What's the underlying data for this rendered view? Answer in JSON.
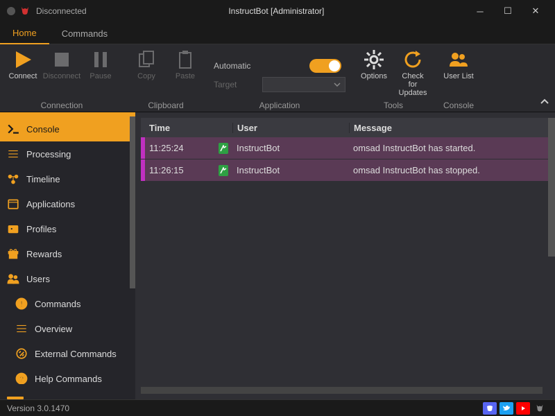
{
  "window": {
    "status": "Disconnected",
    "title": "InstructBot [Administrator]"
  },
  "tabs": [
    {
      "label": "Home",
      "active": true
    },
    {
      "label": "Commands",
      "active": false
    }
  ],
  "ribbon": {
    "connection": {
      "label": "Connection",
      "connect": "Connect",
      "disconnect": "Disconnect",
      "pause": "Pause"
    },
    "clipboard": {
      "label": "Clipboard",
      "copy": "Copy",
      "paste": "Paste"
    },
    "application": {
      "label": "Application",
      "automatic": "Automatic",
      "target": "Target"
    },
    "tools": {
      "label": "Tools",
      "options": "Options",
      "checkupdates": "Check for Updates"
    },
    "console": {
      "label": "Console",
      "userlist": "User List"
    }
  },
  "sidebar": {
    "items": [
      {
        "label": "Console",
        "icon": "terminal",
        "active": true
      },
      {
        "label": "Processing",
        "icon": "processing"
      },
      {
        "label": "Timeline",
        "icon": "timeline"
      },
      {
        "label": "Applications",
        "icon": "applications"
      },
      {
        "label": "Profiles",
        "icon": "profiles"
      },
      {
        "label": "Rewards",
        "icon": "rewards"
      },
      {
        "label": "Users",
        "icon": "users"
      },
      {
        "label": "Commands",
        "icon": "commands",
        "indent": true
      },
      {
        "label": "Overview",
        "icon": "overview",
        "indent": true
      },
      {
        "label": "External Commands",
        "icon": "external",
        "indent": true
      },
      {
        "label": "Help Commands",
        "icon": "help",
        "indent": true
      }
    ]
  },
  "table": {
    "headers": {
      "time": "Time",
      "user": "User",
      "message": "Message"
    },
    "rows": [
      {
        "time": "11:25:24",
        "user": "InstructBot",
        "message": "omsad InstructBot has started."
      },
      {
        "time": "11:26:15",
        "user": "InstructBot",
        "message": "omsad InstructBot has stopped."
      }
    ]
  },
  "statusbar": {
    "version": "Version 3.0.1470"
  }
}
